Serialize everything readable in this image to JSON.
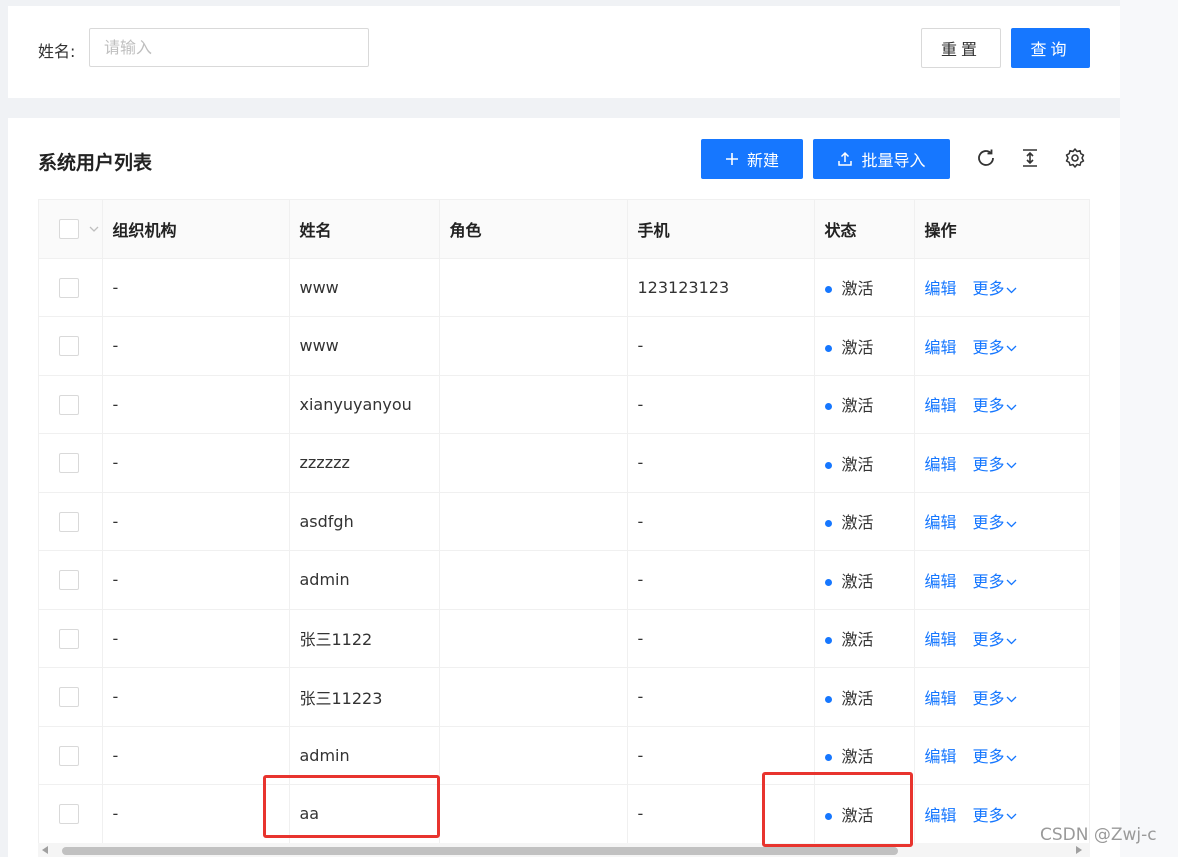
{
  "search": {
    "label": "姓名:",
    "placeholder": "请输入",
    "value": "",
    "reset_label": "重置",
    "query_label": "查询"
  },
  "list": {
    "title": "系统用户列表",
    "new_label": "新建",
    "import_label": "批量导入",
    "icons": [
      "reload-icon",
      "column-height-icon",
      "setting-icon"
    ]
  },
  "table": {
    "columns": [
      "组织机构",
      "姓名",
      "角色",
      "手机",
      "状态",
      "操作"
    ],
    "edit_label": "编辑",
    "more_label": "更多",
    "rows": [
      {
        "org": "-",
        "name": "www",
        "role": "",
        "phone": "123123123",
        "status": "激活"
      },
      {
        "org": "-",
        "name": "www",
        "role": "",
        "phone": "-",
        "status": "激活"
      },
      {
        "org": "-",
        "name": "xianyuyanyou",
        "role": "",
        "phone": "-",
        "status": "激活"
      },
      {
        "org": "-",
        "name": "zzzzzz",
        "role": "",
        "phone": "-",
        "status": "激活"
      },
      {
        "org": "-",
        "name": "asdfgh",
        "role": "",
        "phone": "-",
        "status": "激活"
      },
      {
        "org": "-",
        "name": "admin",
        "role": "",
        "phone": "-",
        "status": "激活"
      },
      {
        "org": "-",
        "name": "张三1122",
        "role": "",
        "phone": "-",
        "status": "激活"
      },
      {
        "org": "-",
        "name": "张三11223",
        "role": "",
        "phone": "-",
        "status": "激活"
      },
      {
        "org": "-",
        "name": "admin",
        "role": "",
        "phone": "-",
        "status": "激活"
      },
      {
        "org": "-",
        "name": "aa",
        "role": "",
        "phone": "-",
        "status": "激活"
      }
    ]
  },
  "colors": {
    "primary": "#1677ff",
    "highlight": "#e8342e"
  },
  "watermark": "CSDN @Zwj-c"
}
